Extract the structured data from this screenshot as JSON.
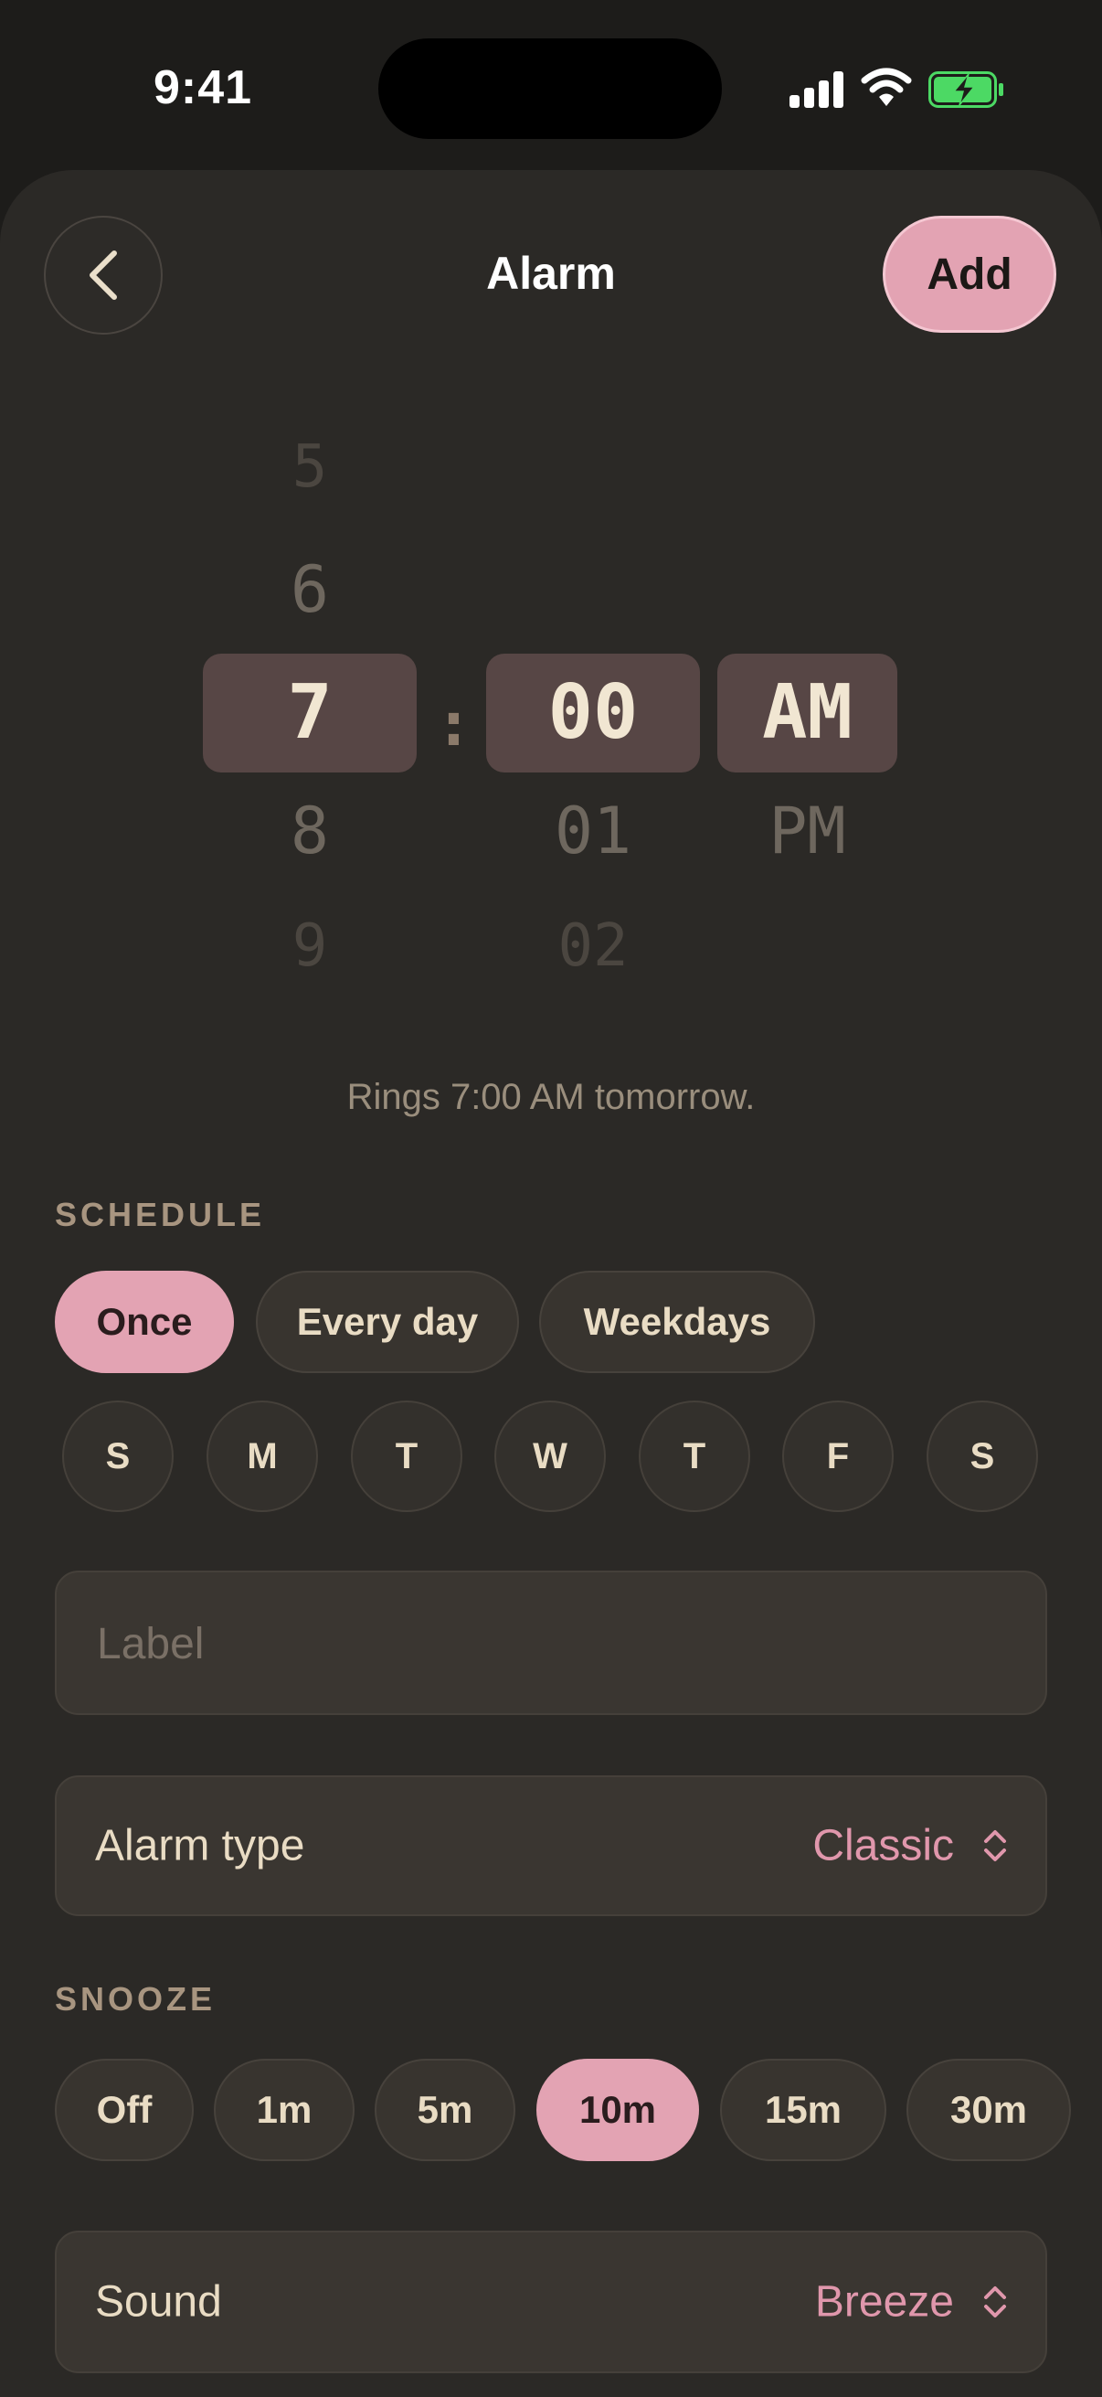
{
  "status_bar": {
    "time": "9:41"
  },
  "header": {
    "title": "Alarm",
    "add_label": "Add"
  },
  "picker": {
    "hours": [
      "5",
      "6",
      "7",
      "8",
      "9"
    ],
    "minutes": [
      "00",
      "01",
      "02"
    ],
    "periods": [
      "AM",
      "PM"
    ],
    "separator": ":",
    "selected_hour": "7",
    "selected_minute": "00",
    "selected_period": "AM"
  },
  "summary": "Rings 7:00 AM tomorrow.",
  "schedule": {
    "title": "SCHEDULE",
    "options": [
      "Once",
      "Every day",
      "Weekdays"
    ],
    "selected": "Once",
    "days": [
      "S",
      "M",
      "T",
      "W",
      "T",
      "F",
      "S"
    ]
  },
  "label_field": {
    "placeholder": "Label",
    "value": ""
  },
  "alarm_type": {
    "label": "Alarm type",
    "value": "Classic"
  },
  "snooze": {
    "title": "SNOOZE",
    "options": [
      "Off",
      "1m",
      "5m",
      "10m",
      "15m",
      "30m"
    ],
    "selected": "10m"
  },
  "sound": {
    "label": "Sound",
    "value": "Breeze"
  },
  "colors": {
    "background": "#2b2926",
    "accent": "#e3a3b3",
    "accent_text": "#e097ac",
    "picker_selection": "#574645",
    "text": "#e9dcc4",
    "battery": "#4cd964"
  }
}
